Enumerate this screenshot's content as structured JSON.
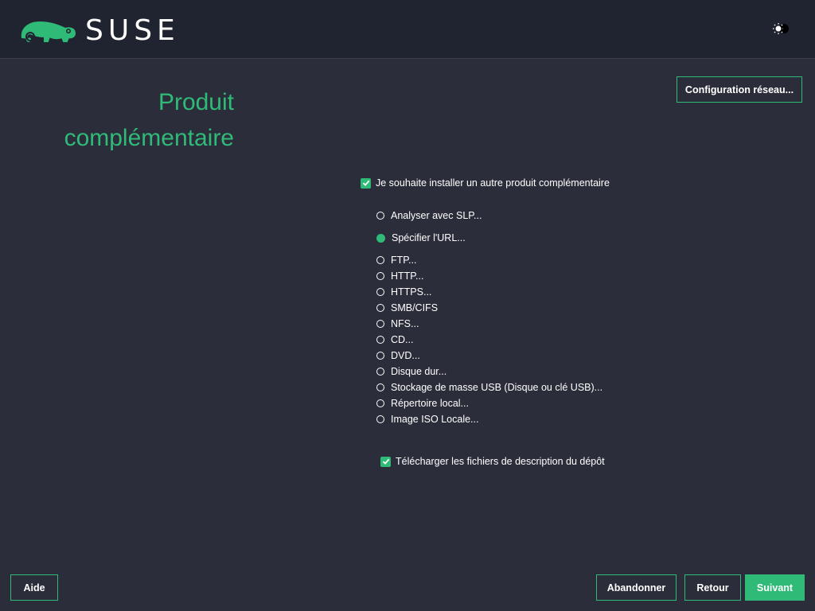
{
  "header": {
    "brand": "SUSE",
    "logo_icon": "suse-chameleon-logo",
    "theme_icon": "theme-toggle-icon"
  },
  "page": {
    "title_line1": "Produit",
    "title_line2": "complémentaire"
  },
  "buttons": {
    "network_config": "Configuration réseau...",
    "help": "Aide",
    "abort": "Abandonner",
    "back": "Retour",
    "next": "Suivant"
  },
  "install_addon": {
    "label": "Je souhaite installer un autre produit complémentaire",
    "checked": true
  },
  "sources": [
    {
      "label": "Analyser avec SLP...",
      "selected": false
    },
    {
      "label": "Spécifier l'URL...",
      "selected": true
    },
    {
      "label": "FTP...",
      "selected": false
    },
    {
      "label": "HTTP...",
      "selected": false
    },
    {
      "label": "HTTPS...",
      "selected": false
    },
    {
      "label": "SMB/CIFS",
      "selected": false
    },
    {
      "label": "NFS...",
      "selected": false
    },
    {
      "label": "CD...",
      "selected": false
    },
    {
      "label": "DVD...",
      "selected": false
    },
    {
      "label": "Disque dur...",
      "selected": false
    },
    {
      "label": "Stockage de masse USB (Disque ou clé USB)...",
      "selected": false
    },
    {
      "label": "Répertoire local...",
      "selected": false
    },
    {
      "label": "Image ISO Locale...",
      "selected": false
    }
  ],
  "download_desc": {
    "label": "Télécharger les fichiers de description du dépôt",
    "checked": true
  },
  "colors": {
    "accent": "#30ba78",
    "background": "#2b2e3a",
    "header": "#202330"
  }
}
